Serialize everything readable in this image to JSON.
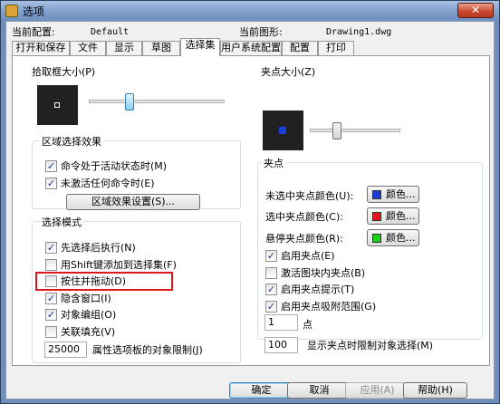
{
  "window": {
    "title": "选项",
    "close_glyph": "✕"
  },
  "header": {
    "current_config_label": "当前配置:",
    "current_config_value": "Default",
    "current_drawing_label": "当前图形:",
    "current_drawing_value": "Drawing1.dwg"
  },
  "tabs": [
    "打开和保存",
    "文件",
    "显示",
    "草图",
    "选择集",
    "用户系统配置",
    "配置",
    "打印"
  ],
  "active_tab": "选择集",
  "pickbox": {
    "title": "拾取框大小(P)",
    "level": 0.3
  },
  "grip_size": {
    "title": "夹点大小(Z)",
    "level": 0.3
  },
  "region_effect": {
    "title": "区域选择效果",
    "items": [
      {
        "label": "命令处于活动状态时(M)",
        "checked": true
      },
      {
        "label": "未激活任何命令时(E)",
        "checked": true
      }
    ],
    "settings_button": "区域效果设置(S)..."
  },
  "selection_mode": {
    "title": "选择模式",
    "items": [
      {
        "label": "先选择后执行(N)",
        "checked": true
      },
      {
        "label": "用Shift键添加到选择集(F)",
        "checked": false
      },
      {
        "label": "按住并拖动(D)",
        "checked": false
      },
      {
        "label": "隐含窗口(I)",
        "checked": true
      },
      {
        "label": "对象编组(O)",
        "checked": true
      },
      {
        "label": "关联填充(V)",
        "checked": false
      }
    ],
    "limit_value": "25000",
    "limit_label": "属性选项板的对象限制(J)"
  },
  "grips": {
    "title": "夹点",
    "colors": [
      {
        "label": "未选中夹点颜色(U):",
        "button": "颜色...",
        "color": "#1a3fd6"
      },
      {
        "label": "选中夹点颜色(C):",
        "button": "颜色...",
        "color": "#e8141c"
      },
      {
        "label": "悬停夹点颜色(R):",
        "button": "颜色...",
        "color": "#18d018"
      }
    ],
    "items": [
      {
        "label": "启用夹点(E)",
        "checked": true
      },
      {
        "label": "激活图块内夹点(B)",
        "checked": false
      },
      {
        "label": "启用夹点提示(T)",
        "checked": true
      },
      {
        "label": "启用夹点吸附范围(G)",
        "checked": true
      }
    ],
    "snap_value": "1",
    "snap_unit": "点",
    "limit_value": "100",
    "limit_label": "显示夹点时限制对象选择(M)"
  },
  "grip_preview_color": "#1a3fd6",
  "footer": {
    "ok": "确定",
    "cancel": "取消",
    "apply": "应用(A)",
    "help": "帮助(H)"
  },
  "checkmark": "✓"
}
